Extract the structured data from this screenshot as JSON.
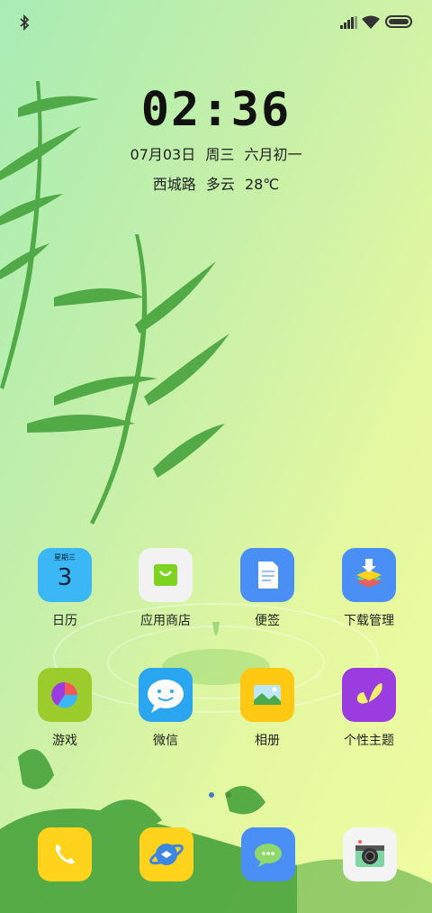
{
  "status_bar": {
    "bluetooth_icon": "bluetooth-icon",
    "signal_icon": "signal-icon",
    "wifi_icon": "wifi-icon",
    "battery_icon": "battery-icon"
  },
  "clock": {
    "time": "02:36"
  },
  "date": {
    "date": "07月03日",
    "weekday": "周三",
    "lunar": "六月初一"
  },
  "weather": {
    "location": "西城路",
    "condition": "多云",
    "temperature": "28℃"
  },
  "apps": [
    {
      "label": "日历",
      "icon": "calendar-icon",
      "icon_text": "星期三",
      "icon_number": "3",
      "color": "#3cb7f5"
    },
    {
      "label": "应用商店",
      "icon": "shopping-bag-icon",
      "color": "#f2f2f2"
    },
    {
      "label": "便签",
      "icon": "note-icon",
      "color": "#4a8ff5"
    },
    {
      "label": "下载管理",
      "icon": "download-icon",
      "color": "#4a8ff5"
    },
    {
      "label": "游戏",
      "icon": "pie-chart-icon",
      "color": "#9ccc2c"
    },
    {
      "label": "微信",
      "icon": "chat-bubble-icon",
      "color": "#2aa6f0"
    },
    {
      "label": "相册",
      "icon": "photo-icon",
      "color": "#ffc812"
    },
    {
      "label": "个性主题",
      "icon": "butterfly-icon",
      "color": "#9a3ce0"
    }
  ],
  "page_indicator": {
    "count": 2,
    "active": 0
  },
  "dock": [
    {
      "icon": "phone-icon",
      "color": "#ffd21c"
    },
    {
      "icon": "browser-icon",
      "color": "#ffd21c"
    },
    {
      "icon": "message-icon",
      "color": "#4a8ff5"
    },
    {
      "icon": "camera-icon",
      "color": "#f4f4f4"
    }
  ]
}
